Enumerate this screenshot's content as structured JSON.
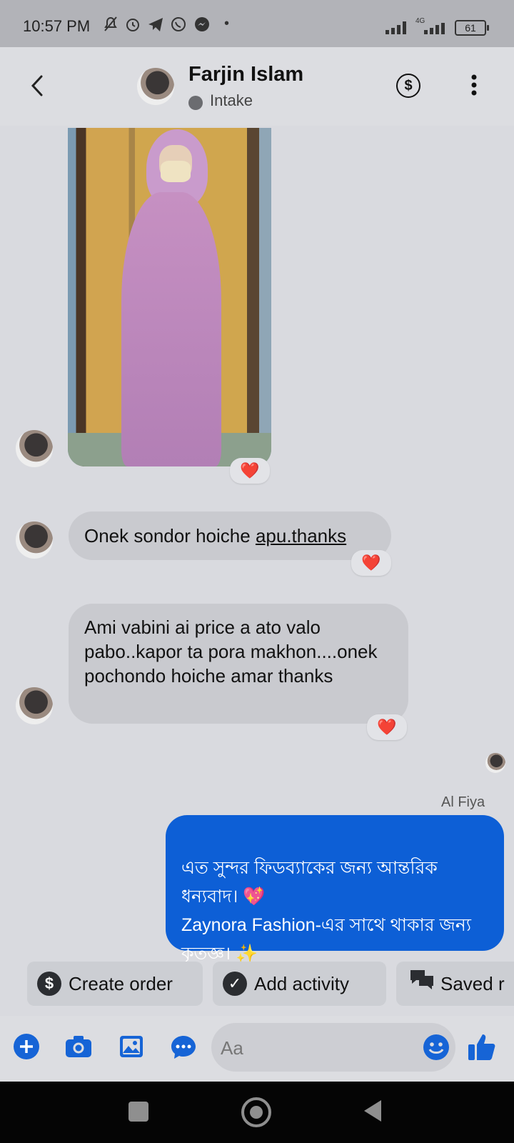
{
  "status_bar": {
    "time": "10:57 PM",
    "network": "4G",
    "battery": "61"
  },
  "header": {
    "name": "Farjin Islam",
    "subtitle": "Intake",
    "back_icon": "chevron-left-icon",
    "payment_icon": "dollar-circle-icon",
    "more_icon": "more-vertical-icon"
  },
  "messages": [
    {
      "type": "image",
      "from": "contact",
      "description": "photo",
      "reaction": "❤️"
    },
    {
      "type": "text",
      "from": "contact",
      "text_before_link": "Onek sondor hoiche ",
      "link_text": "apu.thanks",
      "reaction": "❤️"
    },
    {
      "type": "text",
      "from": "contact",
      "text": "Ami vabini ai price a ato valo pabo..kapor ta pora makhon....onek pochondo hoiche amar thanks",
      "reaction": "❤️"
    },
    {
      "type": "text",
      "from": "me",
      "sender": "Al Fiya",
      "text": "এত সুন্দর ফিডব্যাকের জন্য আন্তরিক ধন্যবাদ। 💖\nZaynora Fashion-এর সাথে থাকার জন্য কৃতজ্ঞ। ✨"
    }
  ],
  "quick_actions": [
    {
      "label": "Create order",
      "icon": "dollar-circle-icon"
    },
    {
      "label": "Add activity",
      "icon": "check-circle-icon"
    },
    {
      "label": "Saved r",
      "icon": "chat-bubbles-icon"
    }
  ],
  "composer": {
    "placeholder": "Aa",
    "icons": [
      "plus-icon",
      "camera-icon",
      "image-icon",
      "chat-dots-icon",
      "emoji-icon",
      "thumbs-up-icon"
    ]
  },
  "colors": {
    "accent": "#0d5fd6",
    "reaction": "#e0242e",
    "background": "#d9dadf"
  }
}
